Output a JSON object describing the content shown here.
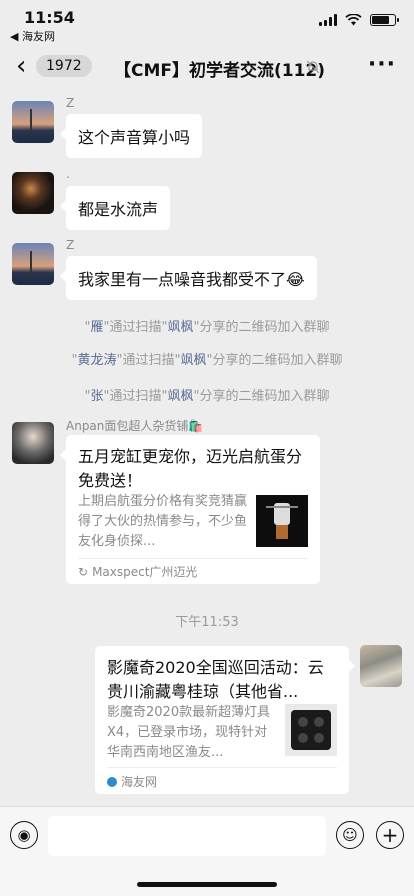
{
  "status_bar": {
    "time": "11:54",
    "back_app": "◀ 海友网"
  },
  "nav": {
    "unread_count": "1972",
    "title": "【CMF】初学者交流(112)"
  },
  "messages": [
    {
      "sender": "Z",
      "text": "这个声音算小吗"
    },
    {
      "sender": ".",
      "text": "都是水流声"
    },
    {
      "sender": "Z",
      "text": "我家里有一点噪音我都受不了😂"
    }
  ],
  "system_messages": [
    {
      "prefix": "\"",
      "name": "雁",
      "mid": "\"通过扫描\"",
      "name2": "飒枫",
      "suffix": "\"分享的二维码加入群聊"
    },
    {
      "prefix": "\"",
      "name": "黄龙涛",
      "mid": "\"通过扫描\"",
      "name2": "飒枫",
      "suffix": "\"分享的二维码加入群聊"
    },
    {
      "prefix": "\"",
      "name": "张",
      "mid": "\"通过扫描\"",
      "name2": "飒枫",
      "suffix": "\"分享的二维码加入群聊"
    }
  ],
  "card1": {
    "sender": "Anpan面包超人杂货铺🛍️",
    "title": "五月宠缸更宠你，迈光启航蛋分免费送！",
    "desc": "上期启航蛋分价格有奖竞猜赢得了大伙的热情参与，不少鱼友化身侦探...",
    "source": "Maxspect广州迈光"
  },
  "timestamp": "下午11:53",
  "card2": {
    "title": "影魔奇2020全国巡回活动：云贵川渝藏粤桂琼（其他省...",
    "desc": "影魔奇2020款最新超薄灯具X4，已登录市场，现特针对华南西南地区渔友...",
    "source": "海友网"
  },
  "icons": {
    "back": "chevron-left-icon",
    "mute": "mute-bell-icon",
    "more": "more-icon",
    "voice": "voice-icon",
    "emoji": "emoji-icon",
    "plus": "plus-icon"
  }
}
